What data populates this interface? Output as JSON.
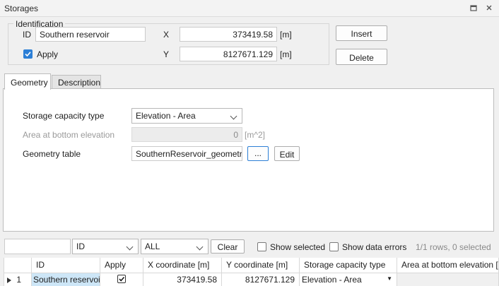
{
  "window": {
    "title": "Storages",
    "restore_icon": "restore-icon",
    "close_icon": "close-icon"
  },
  "identification": {
    "legend": "Identification",
    "id_label": "ID",
    "id_value": "Southern reservoir",
    "apply_label": "Apply",
    "apply_checked": true,
    "x_label": "X",
    "x_value": "373419.58",
    "x_unit": "[m]",
    "y_label": "Y",
    "y_value": "8127671.129",
    "y_unit": "[m]",
    "insert_label": "Insert",
    "delete_label": "Delete"
  },
  "tabs": [
    {
      "label": "Geometry",
      "active": true
    },
    {
      "label": "Description",
      "active": false
    }
  ],
  "geometry": {
    "capacity_type_label": "Storage capacity type",
    "capacity_type_value": "Elevation - Area",
    "bottom_area_label": "Area at bottom elevation",
    "bottom_area_value": "0",
    "bottom_area_unit": "[m^2]",
    "table_label": "Geometry table",
    "table_value": "SouthernReservoir_geometry",
    "browse_label": "...",
    "edit_label": "Edit"
  },
  "filter_bar": {
    "search_value": "",
    "column_select": "ID",
    "value_select": "ALL",
    "clear_label": "Clear",
    "show_selected_label": "Show selected",
    "show_errors_label": "Show data errors",
    "status": "1/1 rows, 0 selected"
  },
  "grid": {
    "columns": [
      "ID",
      "Apply",
      "X coordinate [m]",
      "Y coordinate [m]",
      "Storage capacity type",
      "Area at bottom elevation [m"
    ],
    "rows": [
      {
        "row_number": "1",
        "id": "Southern reservoir",
        "apply": true,
        "x": "373419.58",
        "y": "8127671.129",
        "capacity_type": "Elevation - Area"
      }
    ]
  },
  "colors": {
    "accent": "#2c7fd6",
    "selected_cell": "#cde6f7"
  }
}
